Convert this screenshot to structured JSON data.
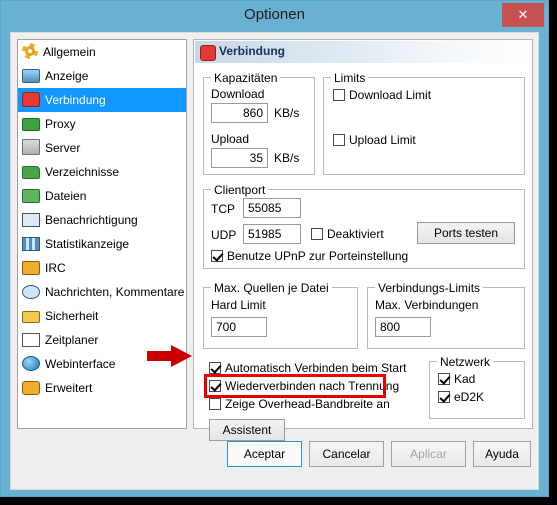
{
  "window": {
    "title": "Optionen",
    "close_label": "✕",
    "frame_color": "#69b1d3",
    "accent_close": "#c75050"
  },
  "sidebar": {
    "items": [
      {
        "label": "Allgemein",
        "icon": "gear-icon",
        "selected": false
      },
      {
        "label": "Anzeige",
        "icon": "monitor-icon",
        "selected": false
      },
      {
        "label": "Verbindung",
        "icon": "plug-icon",
        "selected": true
      },
      {
        "label": "Proxy",
        "icon": "proxy-icon",
        "selected": false
      },
      {
        "label": "Server",
        "icon": "server-icon",
        "selected": false
      },
      {
        "label": "Verzeichnisse",
        "icon": "folder-icon",
        "selected": false
      },
      {
        "label": "Dateien",
        "icon": "files-icon",
        "selected": false
      },
      {
        "label": "Benachrichtigung",
        "icon": "notification-icon",
        "selected": false
      },
      {
        "label": "Statistikanzeige",
        "icon": "statistics-icon",
        "selected": false
      },
      {
        "label": "IRC",
        "icon": "irc-icon",
        "selected": false
      },
      {
        "label": "Nachrichten, Kommentare",
        "icon": "message-icon",
        "selected": false
      },
      {
        "label": "Sicherheit",
        "icon": "lock-icon",
        "selected": false
      },
      {
        "label": "Zeitplaner",
        "icon": "calendar-icon",
        "selected": false
      },
      {
        "label": "Webinterface",
        "icon": "globe-icon",
        "selected": false
      },
      {
        "label": "Erweitert",
        "icon": "advanced-icon",
        "selected": false
      }
    ]
  },
  "panel": {
    "header_title": "Verbindung",
    "header_icon": "plug-icon",
    "capacities": {
      "title": "Kapazitäten",
      "download_label": "Download",
      "download_value": "860",
      "download_unit": "KB/s",
      "upload_label": "Upload",
      "upload_value": "35",
      "upload_unit": "KB/s"
    },
    "limits": {
      "title": "Limits",
      "download_limit_label": "Download Limit",
      "download_limit_checked": false,
      "upload_limit_label": "Upload Limit",
      "upload_limit_checked": false
    },
    "clientport": {
      "title": "Clientport",
      "tcp_label": "TCP",
      "tcp_value": "55085",
      "udp_label": "UDP",
      "udp_value": "51985",
      "disabled_label": "Deaktiviert",
      "disabled_checked": false,
      "test_ports_label": "Ports testen",
      "upnp_label": "Benutze UPnP zur Porteinstellung",
      "upnp_checked": true
    },
    "max_sources": {
      "title": "Max. Quellen je Datei",
      "hard_limit_label": "Hard Limit",
      "hard_limit_value": "700"
    },
    "connection_limits": {
      "title": "Verbindungs-Limits",
      "max_connections_label": "Max. Verbindungen",
      "max_connections_value": "800"
    },
    "options": {
      "autoconnect_label": "Automatisch Verbinden beim Start",
      "autoconnect_checked": true,
      "reconnect_label": "Wiederverbinden nach Trennung",
      "reconnect_checked": true,
      "overhead_label": "Zeige Overhead-Bandbreite an",
      "overhead_checked": false,
      "wizard_label": "Assistent"
    },
    "network": {
      "title": "Netzwerk",
      "kad_label": "Kad",
      "kad_checked": true,
      "ed2k_label": "eD2K",
      "ed2k_checked": true
    }
  },
  "annotation": {
    "highlight_color": "#e60000",
    "arrow_color": "#cc0000",
    "highlight_target": "Wiederverbinden nach Trennung"
  },
  "footer": {
    "accept_label": "Aceptar",
    "cancel_label": "Cancelar",
    "apply_label": "Aplicar",
    "apply_enabled": false,
    "help_label": "Ayuda"
  }
}
